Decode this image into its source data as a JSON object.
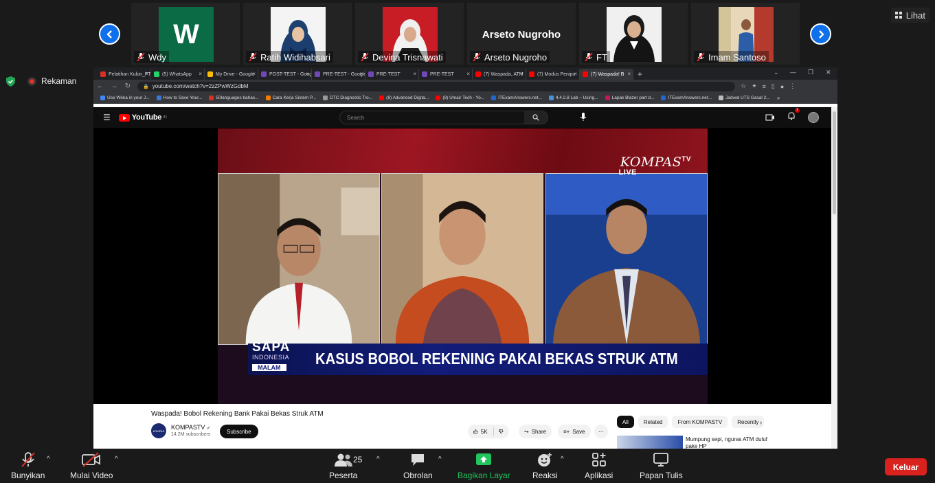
{
  "view_button": "Lihat",
  "recording": "Rekaman",
  "participants": [
    {
      "name": "Wdy",
      "avatar_letter": "W"
    },
    {
      "name": "Ratih Widihabsari"
    },
    {
      "name": "Devina Trisnawati"
    },
    {
      "name": "Arseto Nugroho",
      "display_name": "Arseto Nugroho"
    },
    {
      "name": "FT"
    },
    {
      "name": "Imam Santoso"
    }
  ],
  "browser": {
    "tabs": [
      {
        "label": "Pelatihan Kulon_FT",
        "color": "#d93025"
      },
      {
        "label": "(5) WhatsApp",
        "color": "#25d366"
      },
      {
        "label": "My Drive - Google",
        "color": "#fbbc04"
      },
      {
        "label": "POST-TEST - Goog",
        "color": "#7248b9"
      },
      {
        "label": "PRE-TEST - Google",
        "color": "#7248b9"
      },
      {
        "label": "PRE-TEST",
        "color": "#7248b9"
      },
      {
        "label": "PRE-TEST",
        "color": "#7248b9"
      },
      {
        "label": "(7) Waspada, ATM",
        "color": "#ff0000"
      },
      {
        "label": "(7) Modus Penipu",
        "color": "#ff0000"
      },
      {
        "label": "(7) Waspada! B",
        "color": "#ff0000"
      }
    ],
    "url": "youtube.com/watch?v=2zZPwWzGdbM",
    "bookmarks": [
      {
        "label": "Use Weka in your J...",
        "color": "#4285f4"
      },
      {
        "label": "How to Save Your...",
        "color": "#3c78d8"
      },
      {
        "label": "50languages bahas...",
        "color": "#d93025"
      },
      {
        "label": "Cara Kerja Sistem P...",
        "color": "#f57c00"
      },
      {
        "label": "DTC Diagnostic Tro...",
        "color": "#999999"
      },
      {
        "label": "(8) Advanced Digita...",
        "color": "#ff0000"
      },
      {
        "label": "(8) Umair Tech - Yo...",
        "color": "#ff0000"
      },
      {
        "label": "ITExamAnswers.net...",
        "color": "#2266cc"
      },
      {
        "label": "4.4.2.8 Lab – Using...",
        "color": "#4a90d9"
      },
      {
        "label": "Lapak Blazer part d...",
        "color": "#c2185b"
      },
      {
        "label": "ITExamAnswers.net...",
        "color": "#2266cc"
      },
      {
        "label": "Jadwal UTS Gasal 2...",
        "color": "#bbbbbb"
      }
    ]
  },
  "youtube": {
    "logo": "YouTube",
    "logo_region": "ID",
    "search_placeholder": "Search",
    "notif_count": "7",
    "video_title": "Waspada! Bobol Rekening Bank Pakai Bekas Struk ATM",
    "channel_name": "KOMPASTV",
    "subscribers": "14.2M subscribers",
    "subscribe_label": "Subscribe",
    "like_count": "5K",
    "share_label": "Share",
    "save_label": "Save",
    "chips": [
      "All",
      "Related",
      "From KOMPASTV",
      "Recently"
    ],
    "recommended_title": "Mumpung sepi, nguras ATM duluf pake HP",
    "channel_avatar_text": "KOMPAS"
  },
  "video": {
    "kompas": "KOMPAS",
    "kompas_tv": "TV",
    "live": "LIVE",
    "sapa": "SAPA",
    "indonesia": "INDONESIA",
    "malam": "MALAM",
    "headline": "KASUS BOBOL REKENING PAKAI BEKAS STRUK ATM"
  },
  "toolbar": {
    "unmute": "Bunyikan",
    "start_video": "Mulai Video",
    "participants": "Peserta",
    "participant_count": "25",
    "chat": "Obrolan",
    "share_screen": "Bagikan Layar",
    "reactions": "Reaksi",
    "apps": "Aplikasi",
    "whiteboard": "Papan Tulis",
    "leave": "Keluar"
  }
}
